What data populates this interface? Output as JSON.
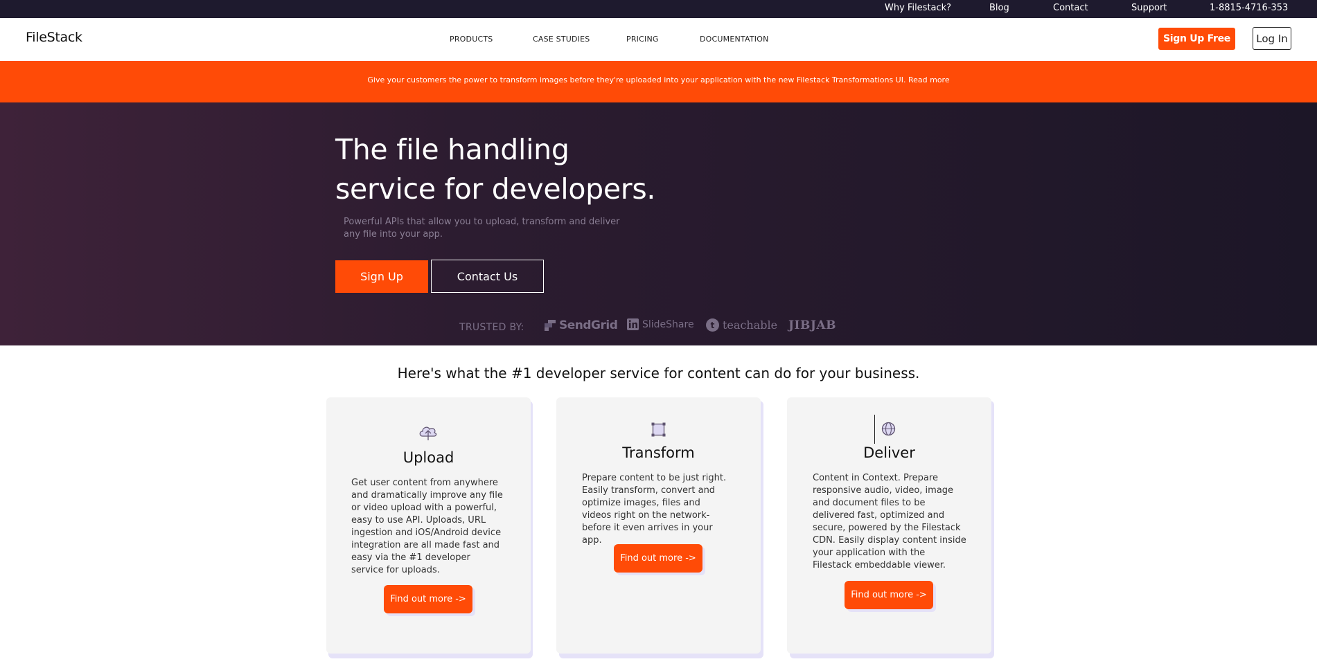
{
  "topbar": {
    "links": [
      "Why Filestack?",
      "Blog",
      "Contact",
      "Support",
      "1-8815-4716-353"
    ]
  },
  "nav": {
    "logo": "FileStack",
    "items": [
      "PRODUCTS",
      "CASE STUDIES",
      "PRICING",
      "DOCUMENTATION"
    ],
    "signup_free": "Sign Up Free",
    "login": "Log In"
  },
  "announcement": {
    "text": "Give your customers the power to transform images before they're uploaded into your application with the new Filestack Transformations UI. Read more"
  },
  "hero": {
    "title_line1": "The file handling",
    "title_line2": "service for developers.",
    "subtitle": "Powerful APIs that allow you to upload, transform and deliver any file into your app.",
    "signup": "Sign Up",
    "contact": "Contact Us",
    "trusted_by": "TRUSTED BY:",
    "brands": [
      "SendGrid",
      "SlideShare",
      "teachable",
      "JIBJAB"
    ]
  },
  "features": {
    "title": "Here's what the #1 developer service for content can do for your business.",
    "cards": [
      {
        "icon": "cloud-upload-icon",
        "title": "Upload",
        "text": "Get user content from anywhere and dramatically improve any file or video upload with a powerful, easy to use API. Uploads, URL ingestion and iOS/Android device integration are all made fast and easy via the #1 developer service for uploads.",
        "cta": "Find out more ->"
      },
      {
        "icon": "transform-icon",
        "title": "Transform",
        "text": "Prepare content to be just right. Easily transform, convert and optimize images, files and videos right on the network-before it even arrives in your app.",
        "cta": "Find out more ->"
      },
      {
        "icon": "globe-icon",
        "title": "Deliver",
        "text": "Content in Context. Prepare responsive audio, video, image and document files to be delivered fast, optimized and secure, powered by the Filestack CDN. Easily display content inside your application with the Filestack embeddable viewer.",
        "cta": "Find out more ->"
      }
    ]
  },
  "colors": {
    "accent": "#ff4b07",
    "topbar": "#1e1a2e",
    "hero_left": "#3e2239",
    "hero_right": "#1c1627",
    "card_bg": "#f4f4f4",
    "card_shadow": "#e5e2f8"
  }
}
